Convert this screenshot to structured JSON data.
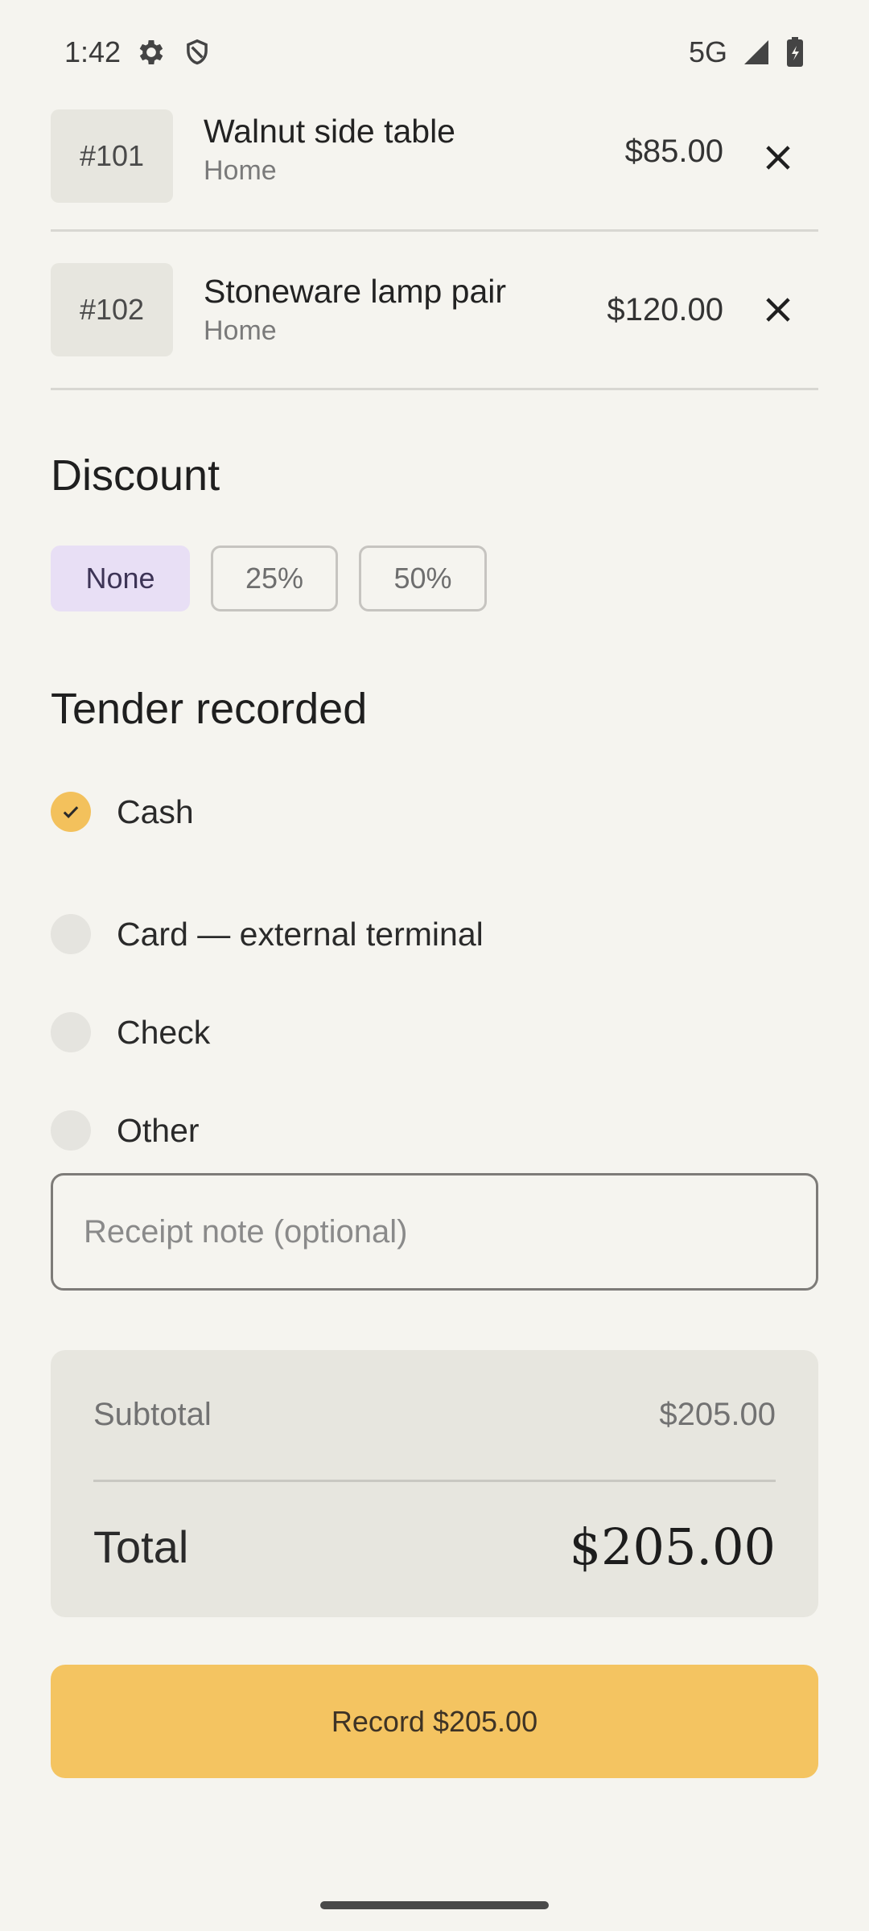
{
  "status_bar": {
    "time": "1:42",
    "network": "5G",
    "icons": [
      "gear-icon",
      "shield-icon",
      "signal-icon",
      "battery-icon"
    ]
  },
  "cart": {
    "items": [
      {
        "sku": "#101",
        "name": "Walnut side table",
        "category": "Home",
        "price": "$85.00"
      },
      {
        "sku": "#102",
        "name": "Stoneware lamp pair",
        "category": "Home",
        "price": "$120.00"
      }
    ]
  },
  "discount": {
    "title": "Discount",
    "options": [
      {
        "label": "None",
        "selected": true
      },
      {
        "label": "25%",
        "selected": false
      },
      {
        "label": "50%",
        "selected": false
      }
    ]
  },
  "tender": {
    "title": "Tender recorded",
    "options": [
      {
        "label": "Cash",
        "checked": true
      },
      {
        "label": "Card — external terminal",
        "checked": false
      },
      {
        "label": "Check",
        "checked": false
      },
      {
        "label": "Other",
        "checked": false
      }
    ]
  },
  "note": {
    "placeholder": "Receipt note (optional)",
    "value": ""
  },
  "summary": {
    "subtotal_label": "Subtotal",
    "subtotal_value": "$205.00",
    "total_label": "Total",
    "total_value": "$205.00"
  },
  "actions": {
    "record_label": "Record $205.00"
  },
  "colors": {
    "background": "#f5f4ef",
    "accent": "#f4c461",
    "chip_selected": "#e8dff5",
    "surface": "#e7e6df"
  }
}
